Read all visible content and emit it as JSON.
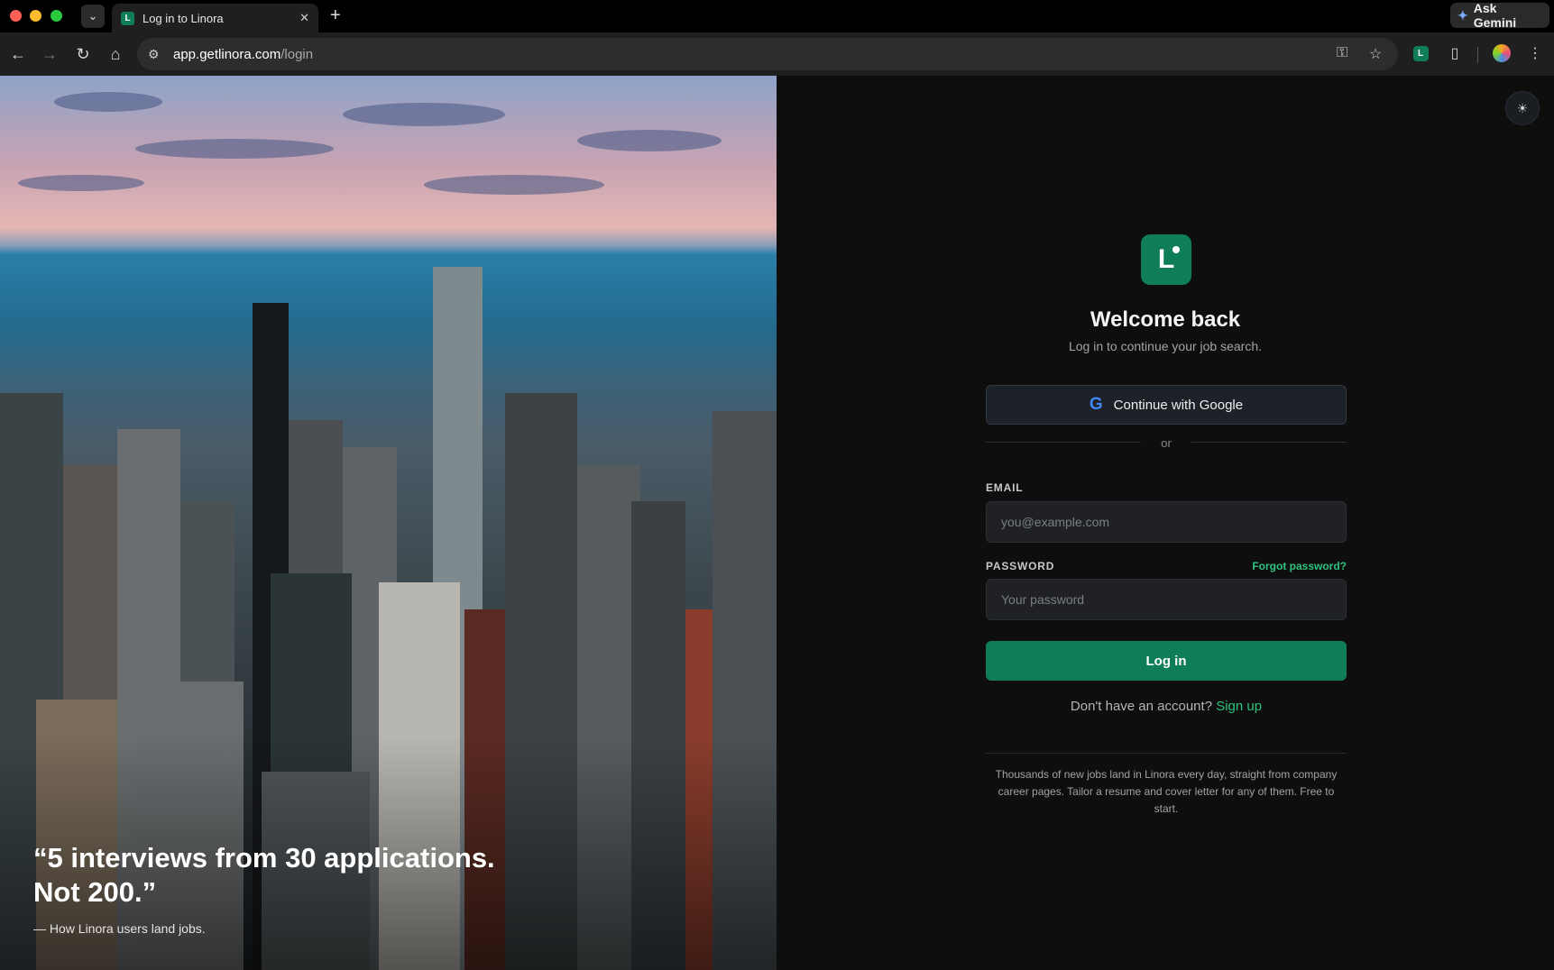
{
  "browser": {
    "tab_title": "Log in to Linora",
    "tab_favicon_letter": "L",
    "ask_gemini_label": "Ask Gemini",
    "url_host": "app.getlinora.com",
    "url_path": "/login"
  },
  "hero": {
    "quote": "“5 interviews from 30 applications. Not 200.”",
    "attribution": "— How Linora users land jobs."
  },
  "login": {
    "logo_letter": "L",
    "heading": "Welcome back",
    "subheading": "Log in to continue your job search.",
    "google_button": "Continue with Google",
    "divider": "or",
    "email_label": "EMAIL",
    "email_placeholder": "you@example.com",
    "password_label": "PASSWORD",
    "forgot_password": "Forgot password?",
    "password_placeholder": "Your password",
    "login_button": "Log in",
    "no_account": "Don't have an account?",
    "signup_link": "Sign up",
    "blurb": "Thousands of new jobs land in Linora every day, straight from company career pages. Tailor a resume and cover letter for any of them. Free to start."
  },
  "colors": {
    "accent": "#0f7d58",
    "link": "#2ec27e",
    "panel_bg": "#0e0e0e"
  },
  "icons": [
    "search-tabs-icon",
    "close-icon",
    "plus-icon",
    "gemini-icon",
    "back-arrow-icon",
    "forward-arrow-icon",
    "reload-icon",
    "home-icon",
    "site-info-icon",
    "password-key-icon",
    "bookmark-star-icon",
    "extensions-icon",
    "more-icon",
    "sun-icon",
    "google-icon"
  ]
}
